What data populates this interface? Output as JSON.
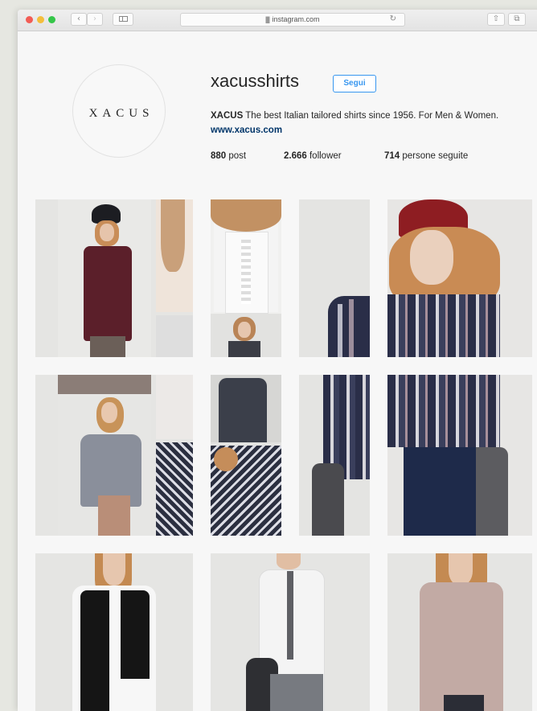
{
  "browser": {
    "url": "instagram.com",
    "icons": [
      "close-icon",
      "minimize-icon",
      "zoom-icon",
      "back-icon",
      "forward-icon",
      "sidebar-icon",
      "lock-icon",
      "reload-icon",
      "share-icon",
      "tabs-icon"
    ]
  },
  "profile": {
    "avatar_text": "XACUS",
    "username": "xacusshirts",
    "follow_label": "Segui",
    "bio_name": "XACUS",
    "bio_text": " The best Italian tailored shirts since 1956. For Men & Women. ",
    "bio_link": "www.xacus.com",
    "stats": [
      {
        "count": "880",
        "label": " post"
      },
      {
        "count": "2.666",
        "label": " follower"
      },
      {
        "count": "714",
        "label": " persone seguite"
      }
    ]
  },
  "colors": {
    "accent": "#3897f0",
    "link": "#003569",
    "burgundy_shirt": "#5b1f2a",
    "red_beanie": "#8e1d22",
    "navy_pants": "#1e2a4a"
  }
}
